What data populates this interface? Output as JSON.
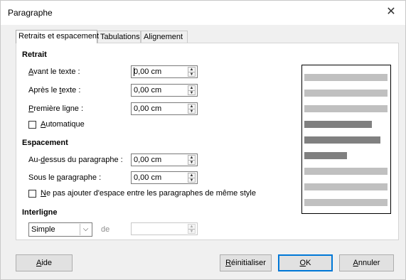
{
  "window": {
    "title": "Paragraphe",
    "close_glyph": "✕"
  },
  "tabs": [
    {
      "label": "Retraits et espacement",
      "active": true
    },
    {
      "label": "Tabulations",
      "active": false
    },
    {
      "label": "Alignement",
      "active": false
    }
  ],
  "retrait": {
    "heading": "Retrait",
    "avant": {
      "label_pre": "",
      "label_key": "A",
      "label_post": "vant le texte :",
      "value": "0,00 cm"
    },
    "apres": {
      "label_pre": "Après le ",
      "label_key": "t",
      "label_post": "exte :",
      "value": "0,00 cm"
    },
    "premiere": {
      "label_pre": "",
      "label_key": "P",
      "label_post": "remière ligne :",
      "value": "0,00 cm"
    },
    "auto": {
      "label_pre": "",
      "label_key": "A",
      "label_post": "utomatique",
      "checked": false
    }
  },
  "espacement": {
    "heading": "Espacement",
    "dessus": {
      "label_pre": "Au-",
      "label_key": "d",
      "label_post": "essus du paragraphe :",
      "value": "0,00 cm"
    },
    "sous": {
      "label_pre": "Sous le ",
      "label_key": "p",
      "label_post": "aragraphe :",
      "value": "0,00 cm"
    },
    "noadd": {
      "label_pre": "",
      "label_key": "N",
      "label_post": "e pas ajouter d'espace entre les paragraphes de même style",
      "checked": false
    }
  },
  "interligne": {
    "heading": "Interligne",
    "selected": "Simple",
    "de_label": "de",
    "value": ""
  },
  "buttons": {
    "aide": {
      "label_pre": "",
      "label_key": "A",
      "label_post": "ide"
    },
    "reinit": {
      "label_pre": "",
      "label_key": "R",
      "label_post": "éinitialiser"
    },
    "ok": {
      "label_pre": "",
      "label_key": "O",
      "label_post": "K"
    },
    "annuler": {
      "label_pre": "",
      "label_key": "A",
      "label_post": "nnuler"
    }
  },
  "colors": {
    "accent": "#0078d7",
    "preview_light": "#c0c0c0",
    "preview_dark": "#808080"
  },
  "icons": {
    "spin_up": "▲",
    "spin_down": "▼",
    "dropdown": "⌵"
  }
}
